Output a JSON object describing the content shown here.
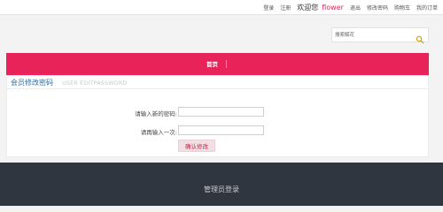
{
  "topbar": {
    "login": "登录",
    "register": "注册",
    "welcome": "欢迎您",
    "username": "flower",
    "logout": "退出",
    "change_password": "修改密码",
    "cart": "购物车",
    "orders": "我的订单"
  },
  "search": {
    "placeholder": "搜索解花",
    "icon": "search-icon"
  },
  "nav": {
    "items": [
      {
        "label": "首页"
      }
    ]
  },
  "panel": {
    "title_cn": "会员修改密码",
    "title_en": "USER EDITPASSWORD",
    "new_password_label": "请输入新的密码:",
    "confirm_password_label": "请再输入一次:",
    "new_password_value": "",
    "confirm_password_value": "",
    "submit_label": "确认修改"
  },
  "footer": {
    "admin_login": "管理员登录"
  },
  "colors": {
    "accent": "#e8235a",
    "footer_bg": "#2f3640",
    "title_blue": "#2e6fa3"
  }
}
